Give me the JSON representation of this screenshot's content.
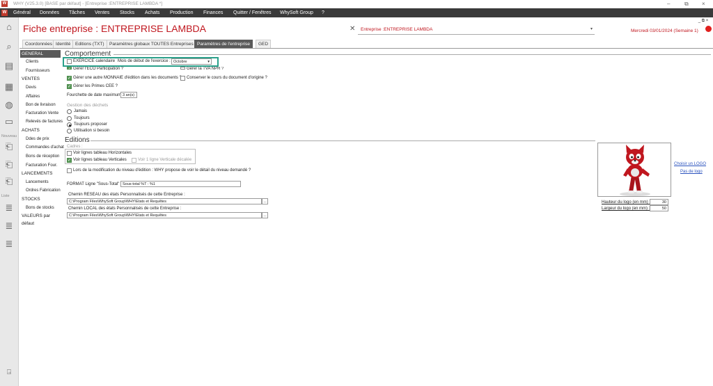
{
  "titlebar": {
    "text": "WHY (V25.3.0) [BASE par défaut] - [Entreprise :ENTREPRISE LAMBDA *]",
    "app_icon": "W"
  },
  "menubar": {
    "items": [
      "Général",
      "Données",
      "Tâches",
      "Ventes",
      "Stocks",
      "Achats",
      "Production",
      "Finances",
      "Quitter / Fenêtres",
      "WhySoft Group",
      "?"
    ],
    "mdi_controls": "_ ⧉ ×"
  },
  "sidebar": {
    "labels": {
      "nouveau": "Nouveau",
      "liste": "Liste"
    }
  },
  "header": {
    "title": "Fiche entreprise : ENTREPRISE LAMBDA",
    "entreprise_select": "Entreprise :ENTREPRISE LAMBDA",
    "date": "Mercredi 03/01/2024 (Semaine 1)"
  },
  "tabs": [
    "Coordonnées",
    "Identité",
    "Editions (TXT)",
    "Paramètres globaux TOUTES Entreprises",
    "Paramètres de l'entreprise",
    "GED"
  ],
  "nav": {
    "general": "GENERAL",
    "general_items": [
      "Clients",
      "Fournisseurs"
    ],
    "ventes": "VENTES",
    "ventes_items": [
      "Devis",
      "Affaires",
      "Bon de livraison",
      "Facturation Vente",
      "Relevés de factures"
    ],
    "achats": "ACHATS",
    "achats_items": [
      "Ddes de prix",
      "Commandes d'achat",
      "Bons de réception",
      "Facturation Four."
    ],
    "lancements": "LANCEMENTS",
    "lancements_items": [
      "Lancements",
      "Ordres Fabrication"
    ],
    "stocks": "STOCKS",
    "stocks_items": [
      "Bons de stocks"
    ],
    "valeurs": "VALEURS par défaut"
  },
  "comportement": {
    "title": "Comportement",
    "exercice_label": "EXERCICE calendaire",
    "mois_label": "Mois de début de l'exercice :",
    "mois_value": "Octobre",
    "gerer_eco": "Gérer l'ECO Participation ?",
    "gerer_tva": "Gérer la TVA NPR ?",
    "gerer_monnaie": "Gérer une autre MONNAIE d'édition dans les documents ?",
    "conserver_cours": "Conserver le cours du document d'origine ?",
    "gerer_primes": "Gérer les Primes CEE ?",
    "fourchette_label": "Fourchette de date maximum :",
    "fourchette_value": "3 an(s)",
    "dechets_title": "Gestion des déchets",
    "dechets_options": [
      "Jamais",
      "Toujours",
      "Toujours proposer",
      "Utilisation si besoin"
    ],
    "dechets_selected": 2
  },
  "editions": {
    "title": "Editions",
    "cadres_label": "Cadres :",
    "voir_horizontales": "Voir lignes tableau Horizontales",
    "voir_verticales": "Voir lignes tableau Verticales",
    "voir_verticale_decalee": "Voir 1 ligne Verticale décalée",
    "lors_modif": "Lors de la modification du niveau d'édition : WHY propose de voir le détail du niveau demandé ?",
    "format_label": "FORMAT Ligne \"Sous-Total\" :",
    "format_value": "Sous-total %T : %1",
    "reseau_label": "Chemin RESEAU des états Personnalisés de cette Entreprise :",
    "reseau_value": "C:\\Program Files\\WhySoft Group\\WHY\\Etats et Requêtes",
    "local_label": "Chemin LOCAL des états Personnalisés de cette Entreprise :",
    "local_value": "C:\\Program Files\\WhySoft Group\\WHY\\Etats et Requêtes",
    "browse": "..."
  },
  "logo": {
    "choisir": "Choisir un LOGO",
    "pas": "Pas de logo",
    "hauteur_label": "Hauteur du logo (en mm) :",
    "hauteur_value": "30",
    "largeur_label": "Largeur du logo (en mm) :",
    "largeur_value": "50"
  },
  "colors": {
    "accent_red": "#c0171f",
    "menubar": "#3a3a3a",
    "highlight": "#2aa08a",
    "checkbox_on": "#5a9a5a"
  }
}
